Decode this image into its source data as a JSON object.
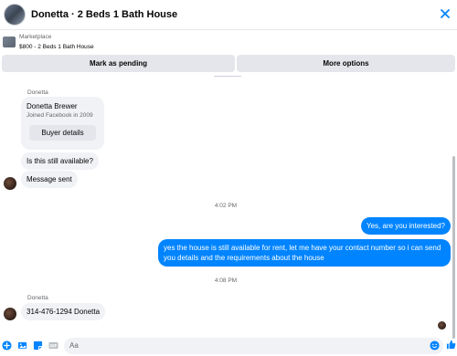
{
  "header": {
    "title": "Donetta · 2 Beds 1 Bath House"
  },
  "marketplace": {
    "label": "Marketplace",
    "listing": "$800 - 2 Beds 1 Bath House"
  },
  "actions": {
    "mark_pending": "Mark as pending",
    "more_options": "More options"
  },
  "conversation": {
    "sender_name_1": "Donetta",
    "profile_card": {
      "name": "Donetta Brewer",
      "joined": "Joined Facebook in 2009",
      "buyer_details": "Buyer details"
    },
    "msg_available": "Is this still available?",
    "msg_sent": "Message sent",
    "time_1": "4:02 PM",
    "reply_1": "Yes, are you interested?",
    "reply_2": "yes the house is still available for rent, let me have your contact number so i can send you details and the requirements about the house",
    "time_2": "4:08 PM",
    "sender_name_2": "Donetta",
    "msg_phone": "314-476-1294 Donetta"
  },
  "composer": {
    "placeholder": "Aa"
  },
  "colors": {
    "accent": "#0084ff",
    "bubble_in": "#f0f2f5",
    "button_bg": "#e4e6eb"
  }
}
